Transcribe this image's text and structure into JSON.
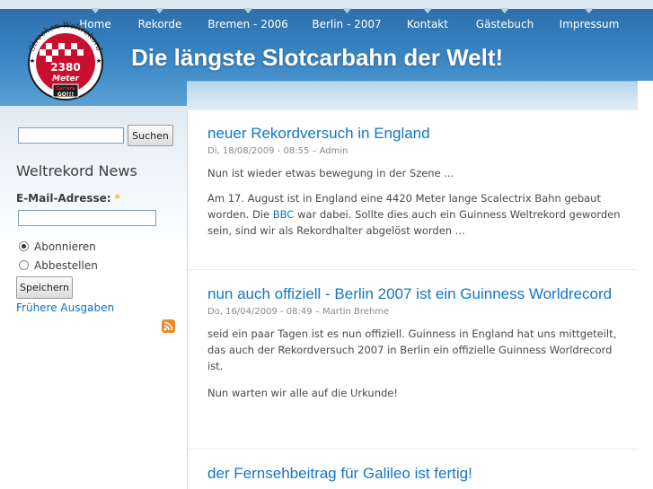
{
  "nav": [
    {
      "label": "Home"
    },
    {
      "label": "Rekorde"
    },
    {
      "label": "Bremen - 2006"
    },
    {
      "label": "Berlin - 2007"
    },
    {
      "label": "Kontakt"
    },
    {
      "label": "Gästebuch"
    },
    {
      "label": "Impressum"
    }
  ],
  "header": {
    "site_name": "Die längste Slotcarbahn der Welt!",
    "logo": {
      "top_text": "Strecken Weltrekord",
      "distance": "2380",
      "unit": "Meter",
      "brand": "Carrera",
      "brand_sub": "GO!!!"
    }
  },
  "sidebar": {
    "search": {
      "value": "",
      "button": "Suchen"
    },
    "newsletter": {
      "title": "Weltrekord News",
      "email_label": "E-Mail-Adresse:",
      "required_mark": "*",
      "email_value": "",
      "subscribe": "Abonnieren",
      "unsubscribe": "Abbestellen",
      "submit": "Speichern",
      "archive_link": "Frühere Ausgaben"
    }
  },
  "posts": [
    {
      "title": "neuer Rekordversuch in England",
      "meta": "Di, 18/08/2009 - 08:55 – Admin",
      "p1": "Nun ist wieder etwas bewegung in der Szene ...",
      "p2_before": "Am 17. August ist in England eine 4420 Meter lange Scalectrix Bahn gebaut worden. Die ",
      "p2_link": "BBC",
      "p2_after": " war dabei. Sollte dies auch ein Guinness Weltrekord geworden sein, sind wir als Rekordhalter abgelöst worden ..."
    },
    {
      "title": "nun auch offiziell - Berlin 2007 ist ein Guinness Worldrecord",
      "meta": "Do, 16/04/2009 - 08:49 – Martin Brehme",
      "p1": "seid ein paar Tagen ist es nun offiziell. Guinness in England hat uns mittgeteilt, das auch der Rekordversuch 2007 in Berlin ein offizielle Guinness Worldrecord ist.",
      "p2": "Nun warten wir alle auf die Urkunde!"
    },
    {
      "title": "der Fernsehbeitrag für Galileo ist fertig!"
    }
  ]
}
